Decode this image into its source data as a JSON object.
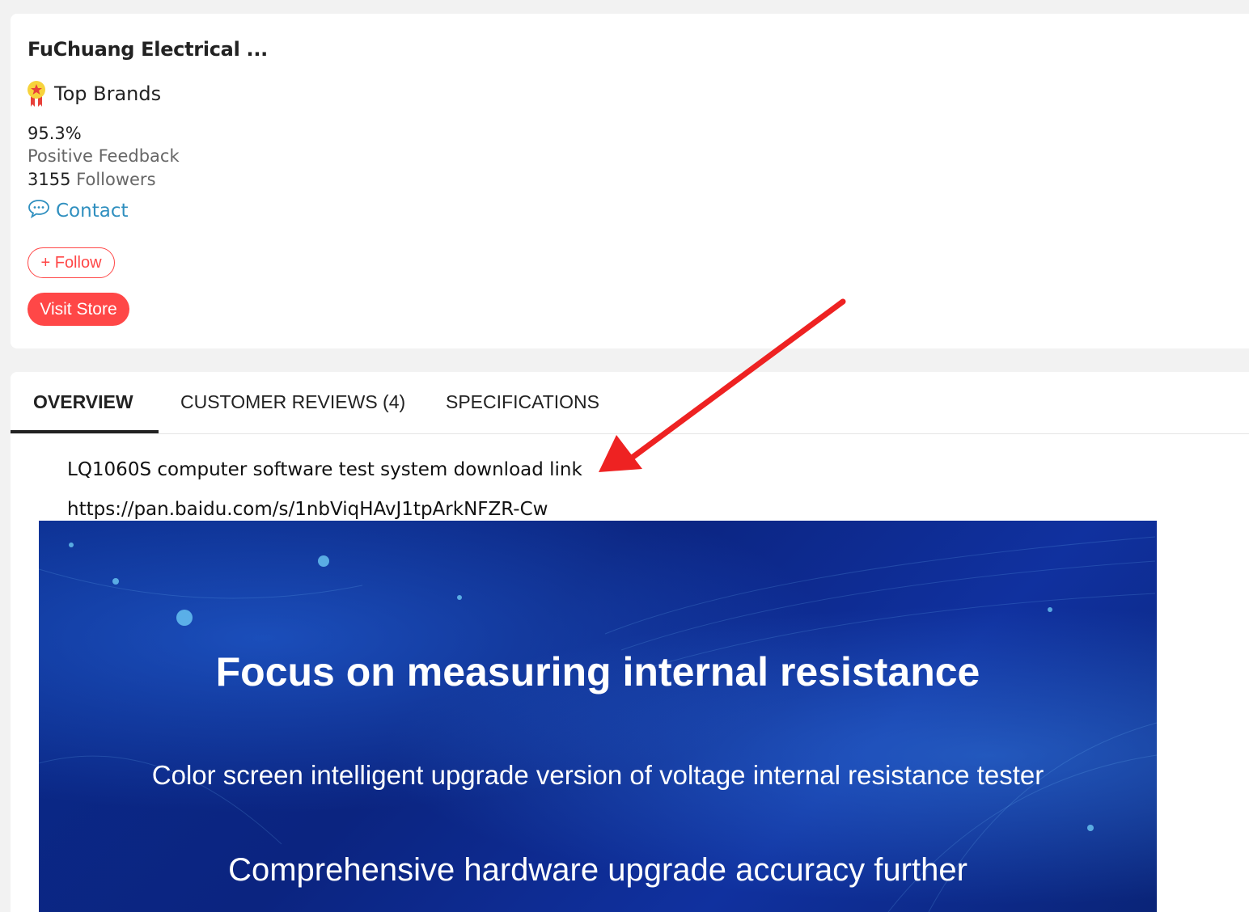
{
  "store": {
    "name": "FuChuang Electrical ...",
    "badge_label": "Top Brands",
    "rating": "95.3%",
    "rating_label": "Positive Feedback",
    "followers_count": "3155",
    "followers_label": "Followers",
    "contact_label": "Contact",
    "follow_label": "+ Follow",
    "visit_label": "Visit Store"
  },
  "tabs": [
    {
      "label": "OVERVIEW",
      "active": true
    },
    {
      "label": "CUSTOMER REVIEWS (4)",
      "active": false
    },
    {
      "label": "SPECIFICATIONS",
      "active": false
    }
  ],
  "overview": {
    "line1": "LQ1060S computer software test system download link",
    "line2": "https://pan.baidu.com/s/1nbViqHAvJ1tpArkNFZR-Cw"
  },
  "banner": {
    "title": "Focus on measuring internal resistance",
    "subtitle1": "Color screen intelligent upgrade version of voltage internal resistance tester",
    "subtitle2": "Comprehensive hardware upgrade accuracy further"
  },
  "colors": {
    "accent": "#ff4747",
    "link": "#2f8fbf",
    "annotation_arrow": "#ee2222"
  },
  "icons": {
    "badge": "medal-icon",
    "contact": "chat-bubble-icon"
  }
}
